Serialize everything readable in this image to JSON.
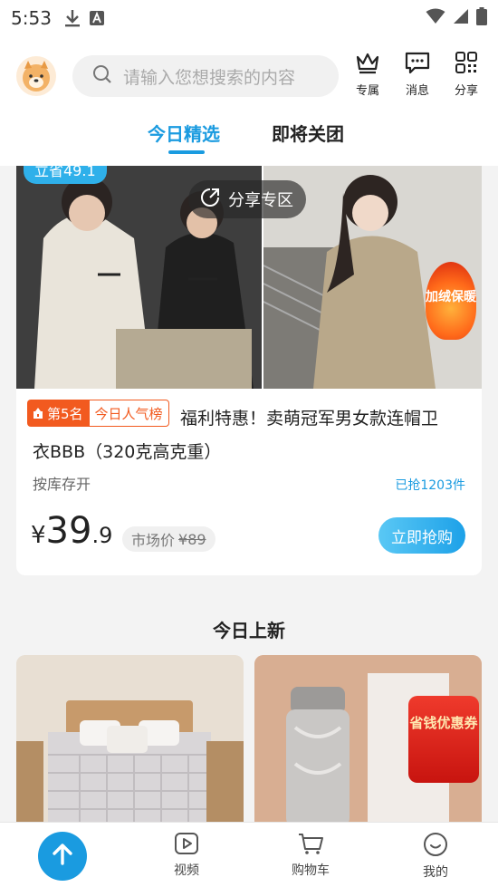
{
  "status_bar": {
    "time": "5:53"
  },
  "header": {
    "search_placeholder": "请输入您想搜索的内容",
    "buttons": [
      {
        "label": "专属",
        "icon": "crown-icon"
      },
      {
        "label": "消息",
        "icon": "message-icon"
      },
      {
        "label": "分享",
        "icon": "qr-code-icon"
      }
    ],
    "tabs": [
      {
        "label": "今日精选",
        "active": true
      },
      {
        "label": "即将关团",
        "active": false
      }
    ]
  },
  "product": {
    "save_badge": "立省49.1",
    "share_label": "分享专区",
    "hot_tag": "加绒保暖",
    "rank": "第5名",
    "rank_tag": "今日人气榜",
    "title_line1": "福利特惠！卖萌冠军男女款连帽卫",
    "title_line2": "衣BBB（320克高克重）",
    "stock": "按库存开",
    "sold": "已抢1203件",
    "price_currency": "¥",
    "price_int": "39",
    "price_dec": ".9",
    "market_label": "市场价",
    "market_price": "¥89",
    "buy_label": "立即抢购"
  },
  "new_today": {
    "title": "今日上新",
    "coupon_text": "省钱优惠券"
  },
  "bottom_nav": {
    "items": [
      {
        "label": "视频",
        "icon": "video-icon"
      },
      {
        "label": "购物车",
        "icon": "cart-icon"
      },
      {
        "label": "我的",
        "icon": "smile-icon"
      }
    ]
  },
  "colors": {
    "accent": "#1a9be0",
    "rank": "#f25a1f"
  }
}
